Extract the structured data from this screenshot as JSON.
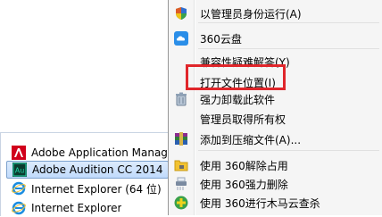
{
  "programs": [
    {
      "label": "Adobe Application Manage",
      "icon": "adobe-icon",
      "selected": false
    },
    {
      "label": "Adobe Audition CC 2014",
      "icon": "audition-icon",
      "selected": true
    },
    {
      "label": "Internet Explorer (64 位)",
      "icon": "ie-icon",
      "selected": false
    },
    {
      "label": "Internet Explorer",
      "icon": "ie-icon",
      "selected": false
    }
  ],
  "menu": {
    "items": [
      {
        "label": "以管理员身份运行(A)",
        "icon": "shield-icon"
      },
      {
        "label": "360云盘",
        "icon": "cloud-icon"
      },
      {
        "label": "兼容性疑难解答(Y)",
        "icon": ""
      },
      {
        "label": "打开文件位置(I)",
        "icon": "",
        "highlighted": true
      },
      {
        "label": "强力卸载此软件",
        "icon": "trash-icon"
      },
      {
        "label": "管理员取得所有权",
        "icon": ""
      },
      {
        "label": "添加到压缩文件(A)...",
        "icon": "archive-icon"
      },
      {
        "label": "使用 360解除占用",
        "icon": "folder-unlock-icon"
      },
      {
        "label": "使用 360强力删除",
        "icon": "shredder-icon"
      },
      {
        "label": "使用 360进行木马云查杀",
        "icon": "360-scan-icon"
      }
    ]
  },
  "colors": {
    "highlight_border": "#e0262b",
    "selected_bg": "#c1dbfc",
    "menu_bg": "#f5f5f5"
  }
}
